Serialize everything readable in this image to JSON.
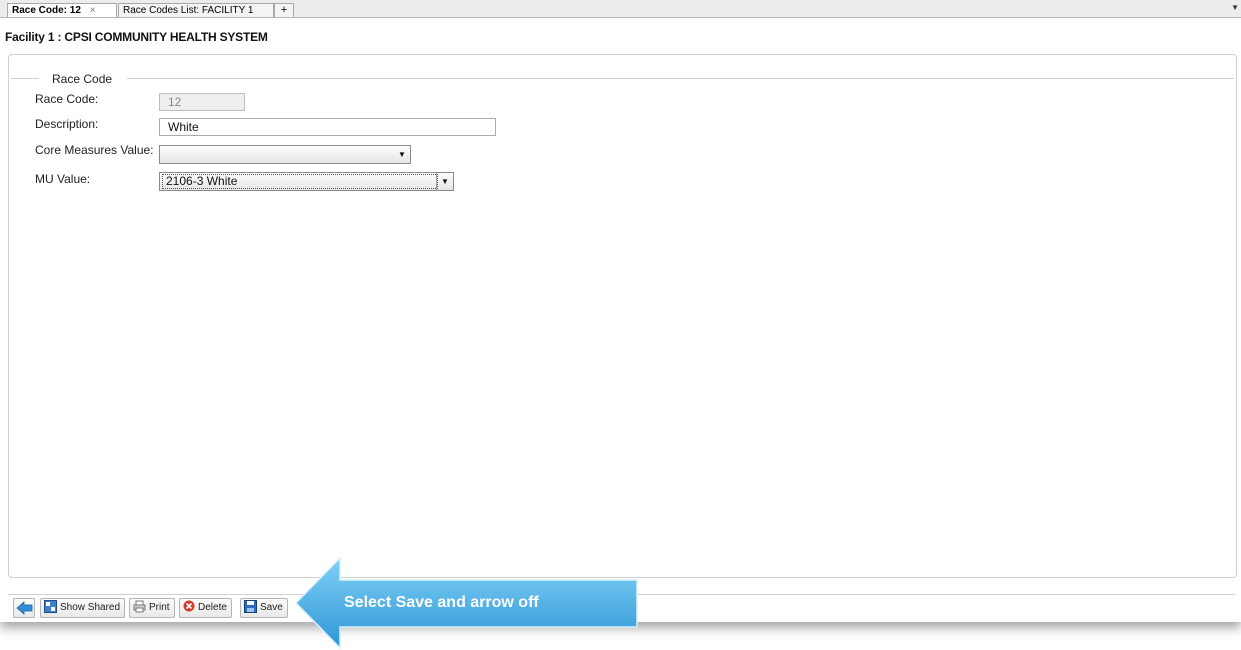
{
  "tabs": [
    {
      "label": "Race Code: 12",
      "close": "×",
      "active": true
    },
    {
      "label": "Race Codes List: FACILITY 1",
      "active": false
    }
  ],
  "tab_add": "+",
  "tab_menu": "▼",
  "facility_header": "Facility 1 : CPSI COMMUNITY HEALTH SYSTEM",
  "form": {
    "legend": "Race Code",
    "race_code": {
      "label": "Race Code:",
      "value": "12"
    },
    "description": {
      "label": "Description:",
      "value": "White"
    },
    "core_measures": {
      "label": "Core Measures Value:",
      "value": ""
    },
    "mu_value": {
      "label": "MU Value:",
      "value": "2106-3 White"
    }
  },
  "toolbar": {
    "back": "",
    "show_shared": "Show Shared",
    "print": "Print",
    "delete": "Delete",
    "save": "Save"
  },
  "callout": {
    "text": "Select Save and arrow off",
    "color": "#4fb3e8"
  }
}
